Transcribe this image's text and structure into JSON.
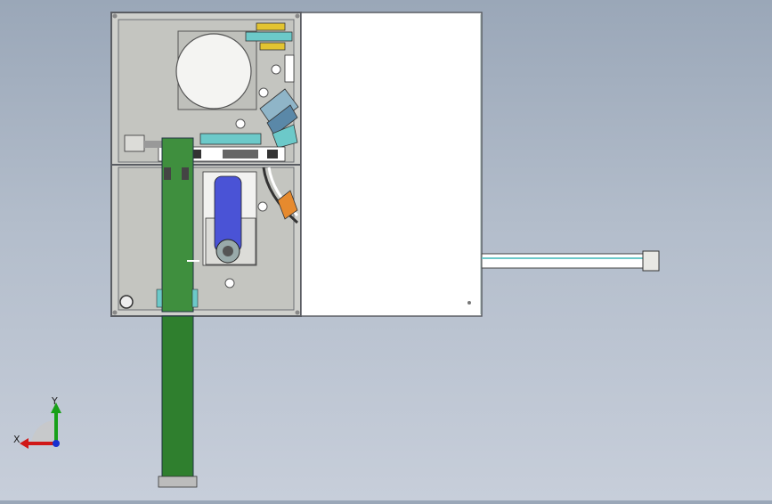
{
  "viewport": {
    "name": "cad-3d-viewport",
    "background": [
      "#9aa7b8",
      "#c7ceda"
    ]
  },
  "model": {
    "name": "packaging-machine-assembly",
    "frame_color": "#cfd0cc",
    "panel_color": "#ffffff",
    "belt_color": "#3f8f3e",
    "motor_color": "#4a53d6",
    "accent_cyan": "#6cc9c9",
    "accent_orange": "#e68a2e"
  },
  "triad": {
    "x_label": "X",
    "y_label": "Y",
    "x_color": "#d01818",
    "y_color": "#18a018",
    "z_color": "#1830d0"
  }
}
